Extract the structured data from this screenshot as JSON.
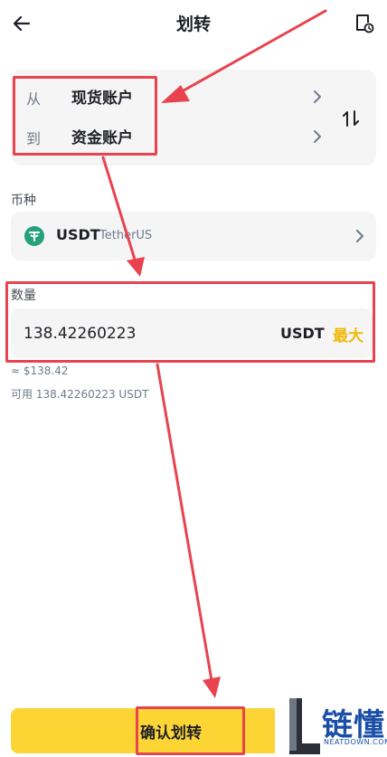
{
  "header": {
    "title": "划转",
    "back_icon": "arrow-left-icon",
    "history_icon": "document-clock-icon"
  },
  "accounts": {
    "from_prefix": "从",
    "from_name": "现货账户",
    "to_prefix": "到",
    "to_name": "资金账户",
    "swap_icon": "swap-vertical-icon"
  },
  "coin": {
    "label": "币种",
    "symbol": "USDT",
    "name": "TetherUS",
    "logo_color": "#26a17b"
  },
  "amount": {
    "label": "数量",
    "value": "138.42260223",
    "unit": "USDT",
    "max_label": "最大",
    "usd_estimate": "≈ $138.42",
    "available_text": "可用 138.42260223 USDT"
  },
  "confirm": {
    "label": "确认划转"
  },
  "brand": {
    "letter": "L",
    "name_cn": "链懂",
    "name_en": "NEATDOWN.COM"
  },
  "colors": {
    "accent": "#fcd535",
    "max": "#f0b90b",
    "annotation": "#e8434f",
    "card": "#f5f5f5"
  }
}
